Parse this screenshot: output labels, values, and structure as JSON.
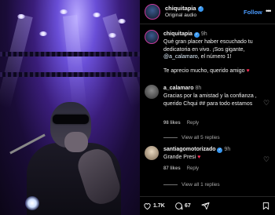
{
  "post": {
    "username": "chiquitapia",
    "audio": "Original audio",
    "follow_label": "Follow",
    "more_label": "•••"
  },
  "caption": {
    "username": "chiquitapia",
    "time": "9h",
    "text_before": "Qué gran placer haber escuchado tu dedicatoria en vivo. ¡Sos gigante, ",
    "mention": "@a_calamaro",
    "text_after": ", el número 1!",
    "line2": "Te aprecio mucho, querido amigo ",
    "line2_emoji": "♥"
  },
  "comments": [
    {
      "username": "a_calamaro",
      "time": "8h",
      "text": "Gracias por la amistad y la confianza , querido Chqui ## para todo estamos",
      "likes": "98 likes",
      "reply_label": "Reply",
      "view_replies": "View all 5 replies"
    },
    {
      "username": "santiagomotorizado",
      "time": "9h",
      "text": "Grande Presi ",
      "text_emoji": "♥",
      "likes": "87 likes",
      "reply_label": "Reply",
      "view_replies": "View all 1 replies"
    }
  ],
  "actions": {
    "like_count": "1.7K",
    "comment_count": "67"
  },
  "colors": {
    "accent": "#4a9bff",
    "verified": "#3897f0",
    "heart": "#ff2d55"
  }
}
